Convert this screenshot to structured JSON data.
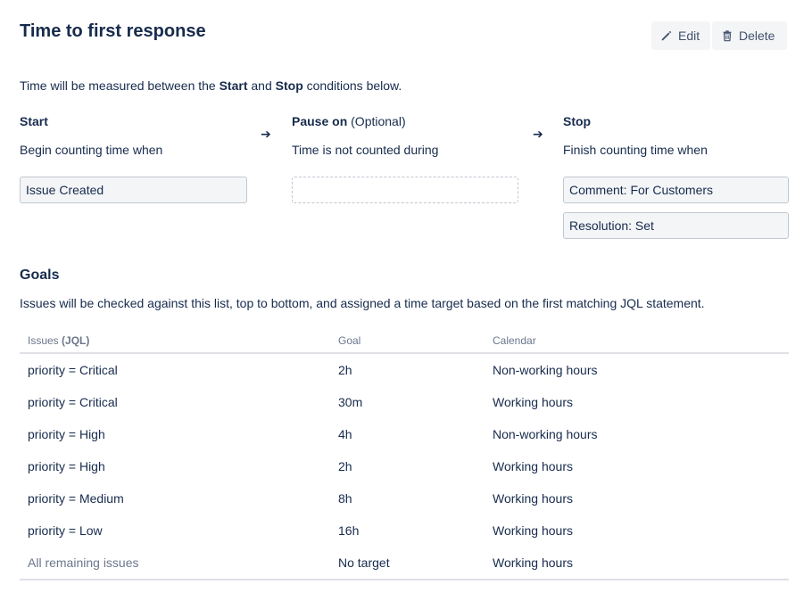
{
  "header": {
    "title": "Time to first response",
    "edit_label": "Edit",
    "delete_label": "Delete"
  },
  "intro": {
    "prefix": "Time will be measured between the ",
    "start_word": "Start",
    "and_word": " and ",
    "stop_word": "Stop",
    "suffix": " conditions below."
  },
  "start": {
    "heading": "Start",
    "description": "Begin counting time when",
    "conditions": [
      "Issue Created"
    ]
  },
  "pause": {
    "heading": "Pause on",
    "optional_label": "(Optional)",
    "description": "Time is not counted during",
    "conditions": []
  },
  "stop": {
    "heading": "Stop",
    "description": "Finish counting time when",
    "conditions": [
      "Comment: For Customers",
      "Resolution: Set"
    ]
  },
  "goals": {
    "title": "Goals",
    "description": "Issues will be checked against this list, top to bottom, and assigned a time target based on the first matching JQL statement.",
    "columns": {
      "issues": "Issues",
      "issues_suffix": "(JQL)",
      "goal": "Goal",
      "calendar": "Calendar"
    },
    "rows": [
      {
        "issues": "priority = Critical",
        "goal": "2h",
        "calendar": "Non-working hours"
      },
      {
        "issues": "priority = Critical",
        "goal": "30m",
        "calendar": "Working hours"
      },
      {
        "issues": "priority = High",
        "goal": "4h",
        "calendar": "Non-working hours"
      },
      {
        "issues": "priority = High",
        "goal": "2h",
        "calendar": "Working hours"
      },
      {
        "issues": "priority = Medium",
        "goal": "8h",
        "calendar": "Working hours"
      },
      {
        "issues": "priority = Low",
        "goal": "16h",
        "calendar": "Working hours"
      },
      {
        "issues": "All remaining issues",
        "goal": "No target",
        "calendar": "Working hours"
      }
    ]
  }
}
